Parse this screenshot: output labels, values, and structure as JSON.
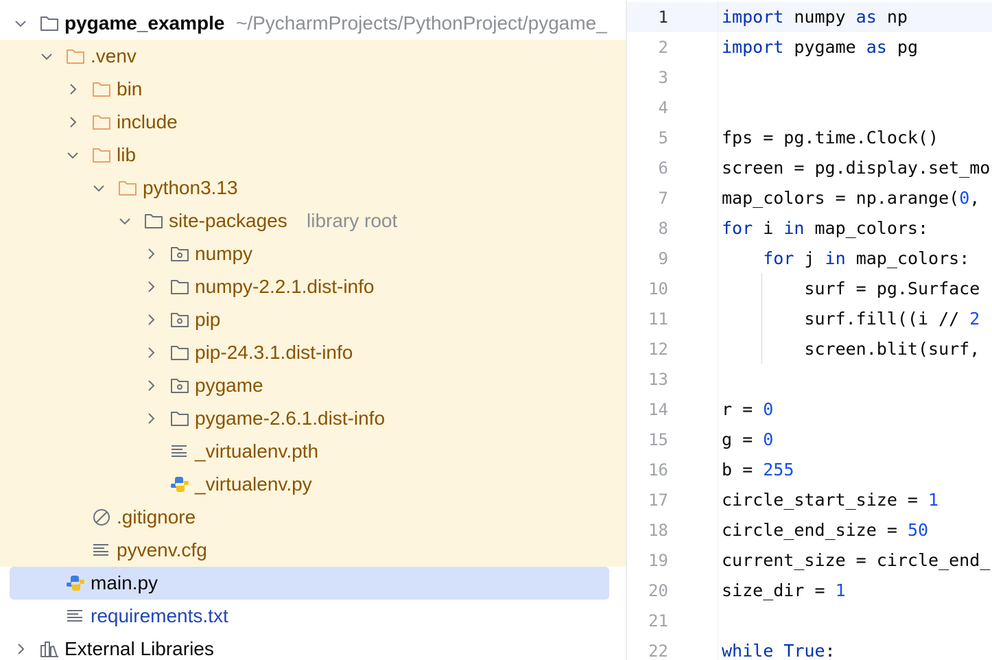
{
  "project_tree": {
    "root": {
      "name": "pygame_example",
      "path": "~/PycharmProjects/PythonProject/pygame_"
    },
    "items": [
      {
        "label": ".venv"
      },
      {
        "label": "bin"
      },
      {
        "label": "include"
      },
      {
        "label": "lib"
      },
      {
        "label": "python3.13"
      },
      {
        "label": "site-packages",
        "hint": "library root"
      },
      {
        "label": "numpy"
      },
      {
        "label": "numpy-2.2.1.dist-info"
      },
      {
        "label": "pip"
      },
      {
        "label": "pip-24.3.1.dist-info"
      },
      {
        "label": "pygame"
      },
      {
        "label": "pygame-2.6.1.dist-info"
      },
      {
        "label": "_virtualenv.pth"
      },
      {
        "label": "_virtualenv.py"
      },
      {
        "label": ".gitignore"
      },
      {
        "label": "pyvenv.cfg"
      },
      {
        "label": "main.py"
      },
      {
        "label": "requirements.txt"
      },
      {
        "label": "External Libraries"
      }
    ],
    "colors": {
      "excluded_text": "#8a5300",
      "excluded_bg": "#fdf5dd",
      "selected_bg": "#d5e1fa",
      "new_file_text": "#1f47b8"
    }
  },
  "editor": {
    "line_numbers": [
      "1",
      "2",
      "3",
      "4",
      "5",
      "6",
      "7",
      "8",
      "9",
      "10",
      "11",
      "12",
      "13",
      "14",
      "15",
      "16",
      "17",
      "18",
      "19",
      "20",
      "21",
      "22"
    ],
    "colors": {
      "keyword": "#0033b3",
      "number": "#1750eb"
    },
    "lines": [
      [
        {
          "t": "import",
          "c": "kw"
        },
        {
          "t": " numpy "
        },
        {
          "t": "as",
          "c": "kw"
        },
        {
          "t": " np"
        }
      ],
      [
        {
          "t": "import",
          "c": "kw"
        },
        {
          "t": " pygame "
        },
        {
          "t": "as",
          "c": "kw"
        },
        {
          "t": " pg"
        }
      ],
      [],
      [],
      [
        {
          "t": "fps = pg.time.Clock()"
        }
      ],
      [
        {
          "t": "screen = pg.display.set_mo"
        }
      ],
      [
        {
          "t": "map_colors = np.arange("
        },
        {
          "t": "0",
          "c": "num"
        },
        {
          "t": ", "
        }
      ],
      [
        {
          "t": "for",
          "c": "kw"
        },
        {
          "t": " i "
        },
        {
          "t": "in",
          "c": "kw"
        },
        {
          "t": " map_colors:"
        }
      ],
      [
        {
          "t": "    "
        },
        {
          "t": "for",
          "c": "kw"
        },
        {
          "t": " j "
        },
        {
          "t": "in",
          "c": "kw"
        },
        {
          "t": " map_colors:"
        }
      ],
      [
        {
          "t": "        surf = pg.Surface"
        }
      ],
      [
        {
          "t": "        surf.fill((i // "
        },
        {
          "t": "2",
          "c": "num"
        }
      ],
      [
        {
          "t": "        screen.blit(surf, "
        }
      ],
      [],
      [
        {
          "t": "r = "
        },
        {
          "t": "0",
          "c": "num"
        }
      ],
      [
        {
          "t": "g = "
        },
        {
          "t": "0",
          "c": "num"
        }
      ],
      [
        {
          "t": "b = "
        },
        {
          "t": "255",
          "c": "num"
        }
      ],
      [
        {
          "t": "circle_start_size = "
        },
        {
          "t": "1",
          "c": "num"
        }
      ],
      [
        {
          "t": "circle_end_size = "
        },
        {
          "t": "50",
          "c": "num"
        }
      ],
      [
        {
          "t": "current_size = circle_end_"
        }
      ],
      [
        {
          "t": "size_dir = "
        },
        {
          "t": "1",
          "c": "num"
        }
      ],
      [],
      [
        {
          "t": "while",
          "c": "kw"
        },
        {
          "t": " "
        },
        {
          "t": "True",
          "c": "kw"
        },
        {
          "t": ":"
        }
      ]
    ]
  }
}
